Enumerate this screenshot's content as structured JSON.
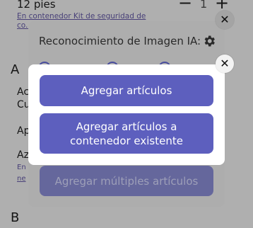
{
  "background": {
    "quantity_label": "12 pies",
    "quantity_minus": "−",
    "quantity_value": "1",
    "quantity_plus": "+",
    "container_link": "En contenedor Kit de seguridad de co...",
    "section_a": "A",
    "item_ac": "Ac",
    "item_cu": "Cu",
    "item_ap": "Ap",
    "item_az": "Az",
    "item_en": "En",
    "item_ne": "ne",
    "section_b": "B"
  },
  "ai_modal": {
    "title": "Reconocimiento de Imagen IA:",
    "icon": "gear-icon",
    "multiple_button": "Agregar múltiples artículos",
    "close_icon": "✕"
  },
  "front_modal": {
    "add_items_button": "Agregar artículos",
    "add_to_existing_button": "Agregar artículos a contenedor existente",
    "close_icon": "✕"
  },
  "colors": {
    "accent": "#5d5fbe",
    "link": "#6a5fb0"
  }
}
